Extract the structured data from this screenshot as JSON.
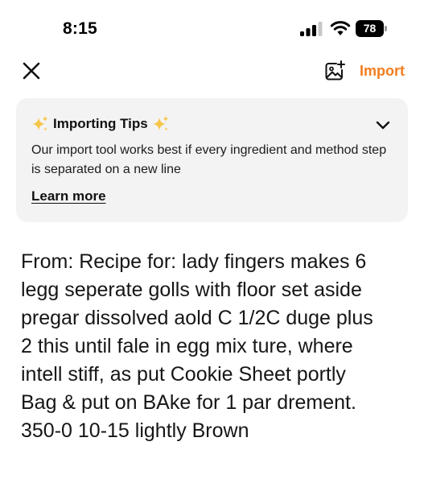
{
  "status_bar": {
    "time": "8:15",
    "battery": "78"
  },
  "toolbar": {
    "close_icon": "close-icon",
    "photo_icon": "add-photo-icon",
    "import_label": "Import",
    "accent_color": "#f37d1e"
  },
  "tips": {
    "title": "Importing Tips",
    "icon_left": "sparkles-icon",
    "icon_right": "sparkles-icon",
    "body": "Our import tool works best if every ingredient and method step is separated on a new line",
    "learn_more": "Learn more"
  },
  "recipe": {
    "text": "From: Recipe for: lady fingers makes 6\nlegg seperate golls with floor set aside\npregar dissolved aold C 1/2C duge plus\n2 this until fale in egg mix ture, where\nintell stiff, as put Cookie Sheet portly\nBag & put on BAke for 1 par drement.\n350-0 10-15 lightly Brown"
  }
}
